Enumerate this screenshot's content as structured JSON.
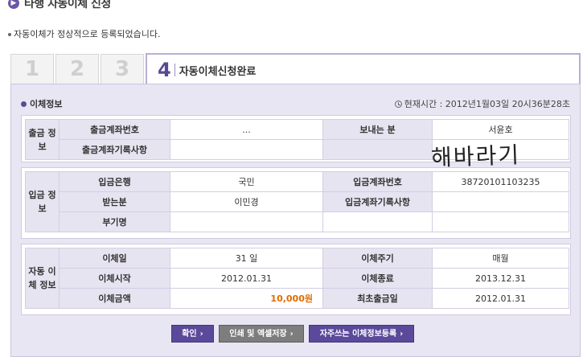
{
  "page": {
    "title": "타행 자동이체 신청",
    "notice": "자동이체가 정상적으로 등록되었습니다."
  },
  "tabs": [
    {
      "label": "1"
    },
    {
      "label": "2"
    },
    {
      "label": "3"
    },
    {
      "label": "4",
      "title": "자동이체신청완료"
    }
  ],
  "section": {
    "title": "이체정보",
    "current_time_label": "현재시간",
    "current_time": "2012년1월03일 20시36분28초"
  },
  "withdrawal": {
    "group": "출금 정보",
    "account_no_label": "출금계좌번호",
    "account_no": "...",
    "sender_label": "보내는 분",
    "sender": "서윤호",
    "memo_label": "출금계좌기록사항",
    "memo": "",
    "handwritten_note": "해바라기"
  },
  "deposit": {
    "group": "입금 정보",
    "bank_label": "입금은행",
    "bank": "국민",
    "account_no_label": "입금계좌번호",
    "account_no": "38720101103235",
    "receiver_label": "받는분",
    "receiver": "이민경",
    "memo_label": "입금계좌기록사항",
    "memo": "",
    "extra_label": "부기명",
    "extra": ""
  },
  "auto_transfer": {
    "group": "자동 이체 정보",
    "day_label": "이체일",
    "day": "31 일",
    "cycle_label": "이체주기",
    "cycle": "매월",
    "start_label": "이체시작",
    "start": "2012.01.31",
    "end_label": "이체종료",
    "end": "2013.12.31",
    "amount_label": "이체금액",
    "amount": "10,000원",
    "first_label": "최초출금일",
    "first": "2012.01.31"
  },
  "buttons": {
    "confirm": "확인",
    "print": "인쇄 및 엑셀저장",
    "save_favorite": "자주쓰는 이체정보등록",
    "arrow": "›"
  },
  "colors": {
    "accent": "#5b4a9b",
    "panel_bg": "#e9e6f3",
    "amount": "#e26a00"
  }
}
